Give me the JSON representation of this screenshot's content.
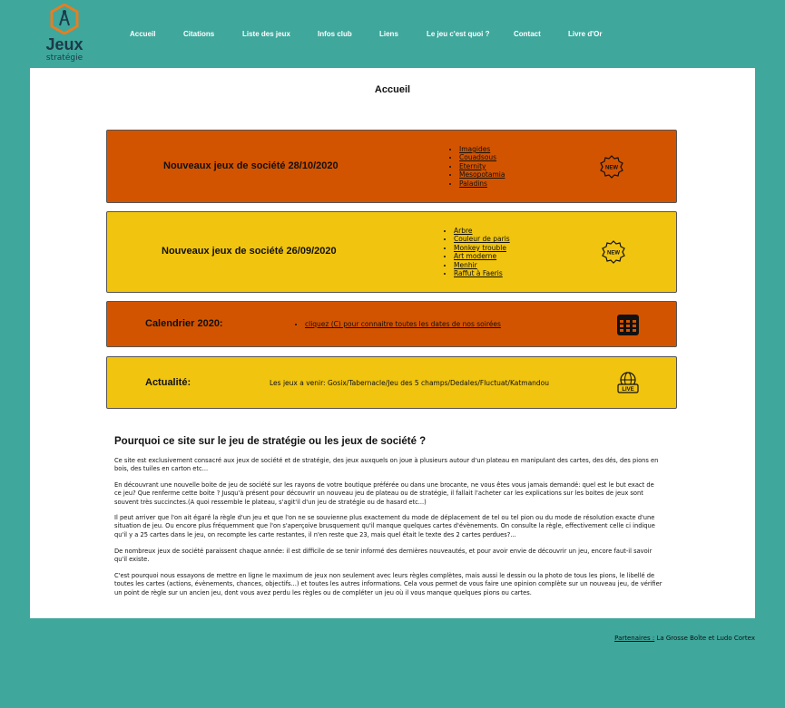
{
  "logo": {
    "word": "Jeux",
    "sub": "stratégie"
  },
  "nav": [
    {
      "label": "Accueil"
    },
    {
      "label": "Citations"
    },
    {
      "label": "Liste des jeux"
    },
    {
      "label": "Infos club"
    },
    {
      "label": "Liens"
    },
    {
      "label": "Le jeu c'est quoi ?"
    },
    {
      "label": "Contact"
    },
    {
      "label": "Livre d'Or"
    }
  ],
  "page_title": "Accueil",
  "bands": {
    "new1": {
      "title": "Nouveaux jeux de société 28/10/2020",
      "items": [
        "Imagides",
        "Couadsous",
        "Eternity",
        "Mesopotamia",
        "Paladins"
      ],
      "icon": "new-badge-icon",
      "badge_text": "NEW"
    },
    "new2": {
      "title": "Nouveaux jeux de société 26/09/2020",
      "items": [
        "Arbre",
        "Couleur de paris",
        "Monkey trouble",
        "Art moderne",
        "Menhir",
        "Raffut à Faeris"
      ],
      "icon": "new-badge-icon",
      "badge_text": "NEW"
    },
    "calendar": {
      "title": "Calendrier 2020:",
      "link": "cliquez (C) pour connaitre toutes les dates de nos soirées",
      "icon": "calendar-icon"
    },
    "news": {
      "title": "Actualité:",
      "text": "Les jeux a venir: Gosix/Tabernacle/Jeu des 5 champs/Dedales/Fluctuat/Katmandou",
      "icon": "live-globe-icon",
      "badge_text": "LIVE"
    }
  },
  "section": {
    "title": "Pourquoi ce site sur le jeu de stratégie ou les jeux de société ?",
    "paragraphs": [
      "Ce site est exclusivement consacré aux jeux de société et de stratégie, des jeux auxquels on joue à plusieurs autour d'un plateau en manipulant des cartes, des dés, des pions en bois, des tuiles en carton etc...",
      "En découvrant une nouvelle boite de jeu de société sur les rayons de votre boutique préférée ou dans une brocante, ne vous êtes vous jamais demandé: quel est le but exact de ce jeu? Que renferme cette boite ? Jusqu'à présent pour découvrir un nouveau jeu de plateau ou de stratégie, il fallait l'acheter car les explications sur les boites de jeux sont souvent très succinctes.(A quoi ressemble le plateau, s'agit'il d'un jeu de stratégie ou de hasard etc...)",
      "Il peut arriver que l'on ait égaré la règle d'un jeu et que l'on ne se souvienne plus exactement du mode de déplacement de tel ou tel pion ou du mode de résolution exacte d'une situation de jeu. Ou encore plus fréquemment que l'on s'aperçoive brusquement qu'il manque quelques cartes d'évènements. On consulte la règle, effectivement celle ci indique qu'il y a 25 cartes dans le jeu, on recompte les carte restantes, il n'en reste que 23, mais quel était le texte des 2 cartes perdues?...",
      "De nombreux jeux de société paraissent chaque année: il est difficile de se tenir informé des dernières nouveautés, et pour avoir envie de découvrir un jeu, encore faut-il savoir qu'il existe.",
      "C'est pourquoi nous essayons de mettre en ligne le maximum de jeux non seulement avec leurs règles complètes, mais aussi le dessin ou la photo de tous les pions, le libellé de toutes les cartes (actions, évènements, chances, objectifs...) et toutes les autres informations. Cela vous permet de vous faire une opinion complète sur un nouveau jeu, de vérifier un point de règle sur un ancien jeu, dont vous avez perdu les règles ou de compléter un jeu où il vous manque quelques pions ou cartes."
    ]
  },
  "footer": {
    "partners_label": "Partenaires :",
    "partners_text": " La Grosse Boîte et Ludo Cortex"
  },
  "colors": {
    "background": "#3fa79c",
    "orange": "#d35400",
    "yellow": "#f1c40f"
  }
}
